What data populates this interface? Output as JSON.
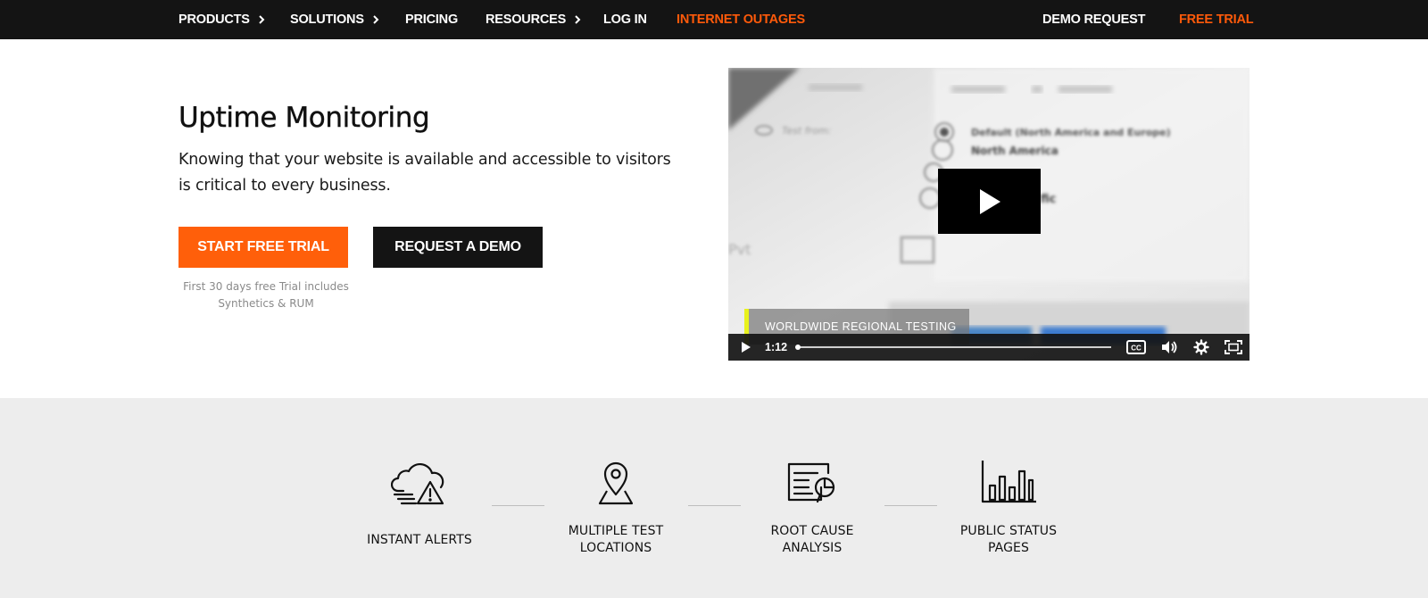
{
  "nav": {
    "products": "PRODUCTS",
    "solutions": "SOLUTIONS",
    "pricing": "PRICING",
    "resources": "RESOURCES",
    "login": "LOG IN",
    "outages": "INTERNET OUTAGES",
    "demo_request": "DEMO REQUEST",
    "free_trial": "FREE TRIAL"
  },
  "hero": {
    "title": "Uptime Monitoring",
    "description": "Knowing that your website is available and accessible to visitors is critical to every business.",
    "start_trial": "START FREE TRIAL",
    "request_demo": "REQUEST A DEMO",
    "trial_note": "First 30 days free Trial includes Synthetics & RUM"
  },
  "video": {
    "caption": "WORLDWIDE REGIONAL TESTING",
    "time": "1:12",
    "progress": 0.0,
    "bg_text": {
      "test_from": "Test from:",
      "option_default": "Default (North America and Europe)",
      "option_na": "North America",
      "option_partial": "fic",
      "label_partial": "Pvt"
    }
  },
  "features": [
    {
      "label_l1": "INSTANT ALERTS",
      "label_l2": "",
      "icon": "cloud-alert-icon"
    },
    {
      "label_l1": "MULTIPLE TEST",
      "label_l2": "LOCATIONS",
      "icon": "map-pin-icon"
    },
    {
      "label_l1": "ROOT CAUSE",
      "label_l2": "ANALYSIS",
      "icon": "analysis-icon"
    },
    {
      "label_l1": "PUBLIC STATUS",
      "label_l2": "PAGES",
      "icon": "bar-chart-icon"
    }
  ],
  "colors": {
    "accent": "#ff5f0a",
    "nav_bg": "#141414",
    "features_bg": "#ededed"
  }
}
